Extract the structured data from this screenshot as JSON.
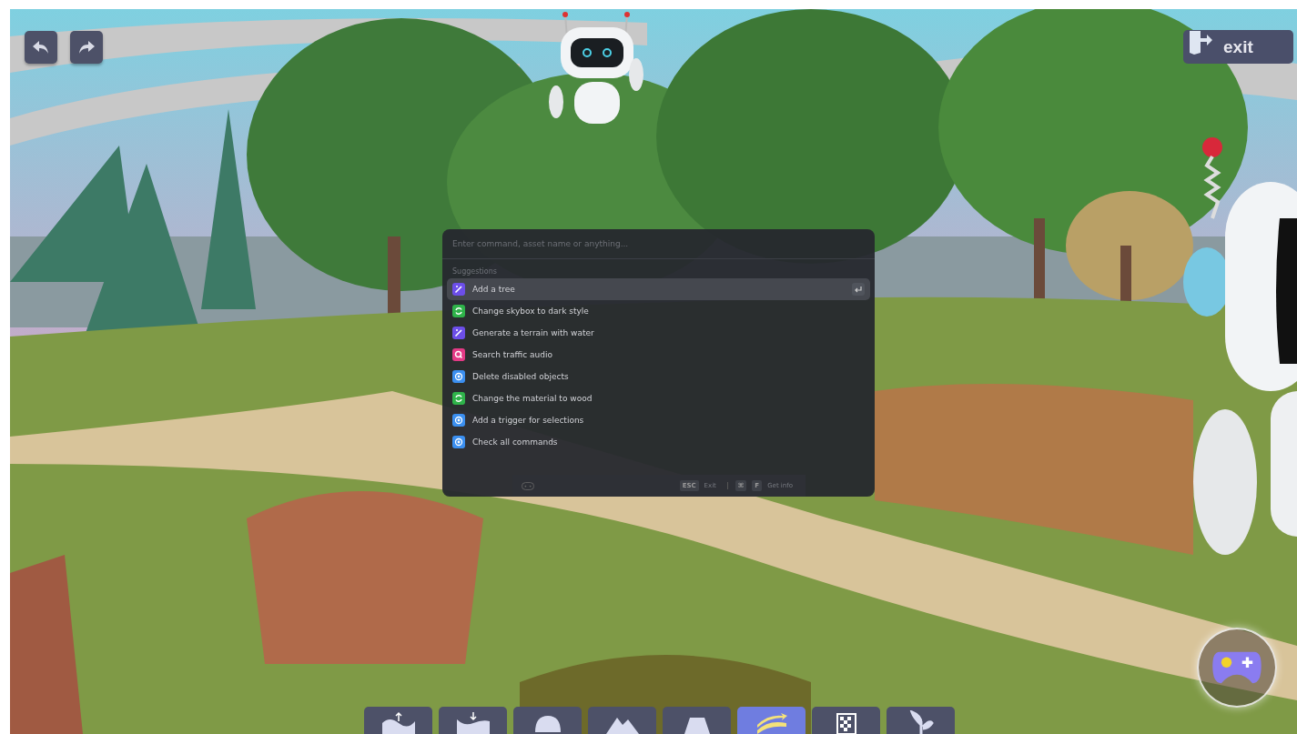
{
  "palette": {
    "placeholder": "Enter command, asset name or anything...",
    "section_label": "Suggestions",
    "items": [
      {
        "label": "Add a tree",
        "kind": "wand",
        "selected": true
      },
      {
        "label": "Change skybox to dark style",
        "kind": "cycle",
        "selected": false
      },
      {
        "label": "Generate a terrain with water",
        "kind": "wand",
        "selected": false
      },
      {
        "label": "Search traffic audio",
        "kind": "search",
        "selected": false
      },
      {
        "label": "Delete disabled objects",
        "kind": "target",
        "selected": false
      },
      {
        "label": "Change the material to wood",
        "kind": "cycle",
        "selected": false
      },
      {
        "label": "Add a trigger for selections",
        "kind": "target",
        "selected": false
      },
      {
        "label": "Check all commands",
        "kind": "target",
        "selected": false
      }
    ],
    "footer": {
      "esc_key": "ESC",
      "esc_label": "Exit",
      "cmd_key": "⌘",
      "f_key": "F",
      "info_label": "Get info"
    }
  },
  "exit_button": {
    "label": "exit"
  },
  "toolbar": [
    {
      "kind": "raise",
      "selected": false
    },
    {
      "kind": "lower",
      "selected": false
    },
    {
      "kind": "dome",
      "selected": false
    },
    {
      "kind": "mountain",
      "selected": false
    },
    {
      "kind": "flatten",
      "selected": false
    },
    {
      "kind": "smooth",
      "selected": true
    },
    {
      "kind": "texture",
      "selected": false
    },
    {
      "kind": "plant",
      "selected": false
    }
  ]
}
